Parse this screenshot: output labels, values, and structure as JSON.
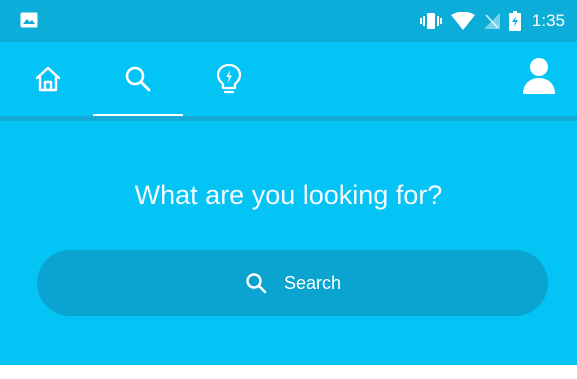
{
  "status_bar": {
    "time": "1:35",
    "icons": [
      "gallery-icon",
      "vibrate-icon",
      "wifi-icon",
      "no-signal-icon",
      "battery-charging-icon"
    ]
  },
  "nav": {
    "tabs": [
      {
        "name": "tab-home",
        "icon": "home-icon",
        "active": false
      },
      {
        "name": "tab-search",
        "icon": "search-icon",
        "active": true
      },
      {
        "name": "tab-ideas",
        "icon": "lightbulb-bolt-icon",
        "active": false
      }
    ],
    "profile_icon": "person-icon"
  },
  "main": {
    "headline": "What are you looking for?",
    "search_label": "Search"
  },
  "colors": {
    "status_bar": "#0dadd9",
    "primary": "#04c3f5",
    "search_pill": "#0ba3d0",
    "text": "#ffffff"
  }
}
